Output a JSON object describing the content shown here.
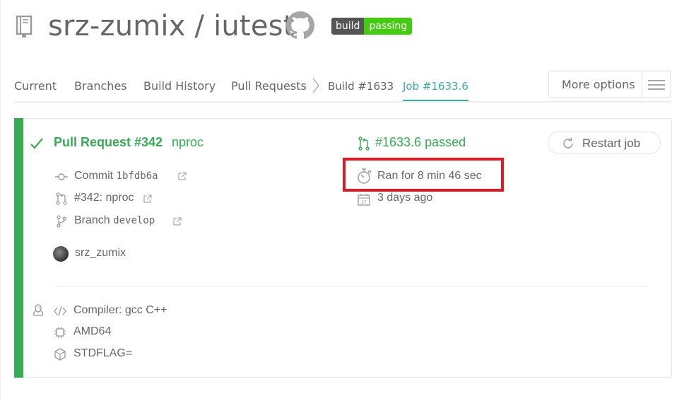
{
  "header": {
    "repo_title": "srz-zumix / iutest",
    "badge": {
      "left": "build",
      "right": "passing",
      "left_color": "#555555",
      "right_color": "#44cc11"
    }
  },
  "nav": {
    "items": [
      {
        "label": "Current"
      },
      {
        "label": "Branches"
      },
      {
        "label": "Build History"
      },
      {
        "label": "Pull Requests"
      },
      {
        "label": "Build #1633"
      },
      {
        "label": "Job #1633.6"
      }
    ],
    "active": "Job #1633.6",
    "more_options": "More options"
  },
  "job": {
    "title": "Pull Request #342",
    "branch_name": "nproc",
    "commit_label": "Commit",
    "commit_hash": "1bfdb6a",
    "pr_ref": "#342: nproc",
    "branch_label": "Branch",
    "branch_value": "develop",
    "author": "srz_zumix",
    "status": "#1633.6 passed",
    "duration": "Ran for 8 min 46 sec",
    "finished": "3 days ago",
    "restart_label": "Restart job",
    "compiler": "Compiler: gcc C++",
    "arch": "AMD64",
    "env": "STDFLAG="
  },
  "colors": {
    "passed": "#39aa56",
    "accent": "#39aaa4",
    "highlight": "#e01922"
  },
  "icons": [
    "repo-icon",
    "github-icon",
    "check-icon",
    "commit-icon",
    "pull-request-icon",
    "branch-icon",
    "external-link-icon",
    "stopwatch-icon",
    "calendar-icon",
    "restart-icon",
    "linux-icon",
    "code-icon",
    "cpu-icon",
    "box-icon",
    "hamburger-icon",
    "chevron-right-icon"
  ]
}
